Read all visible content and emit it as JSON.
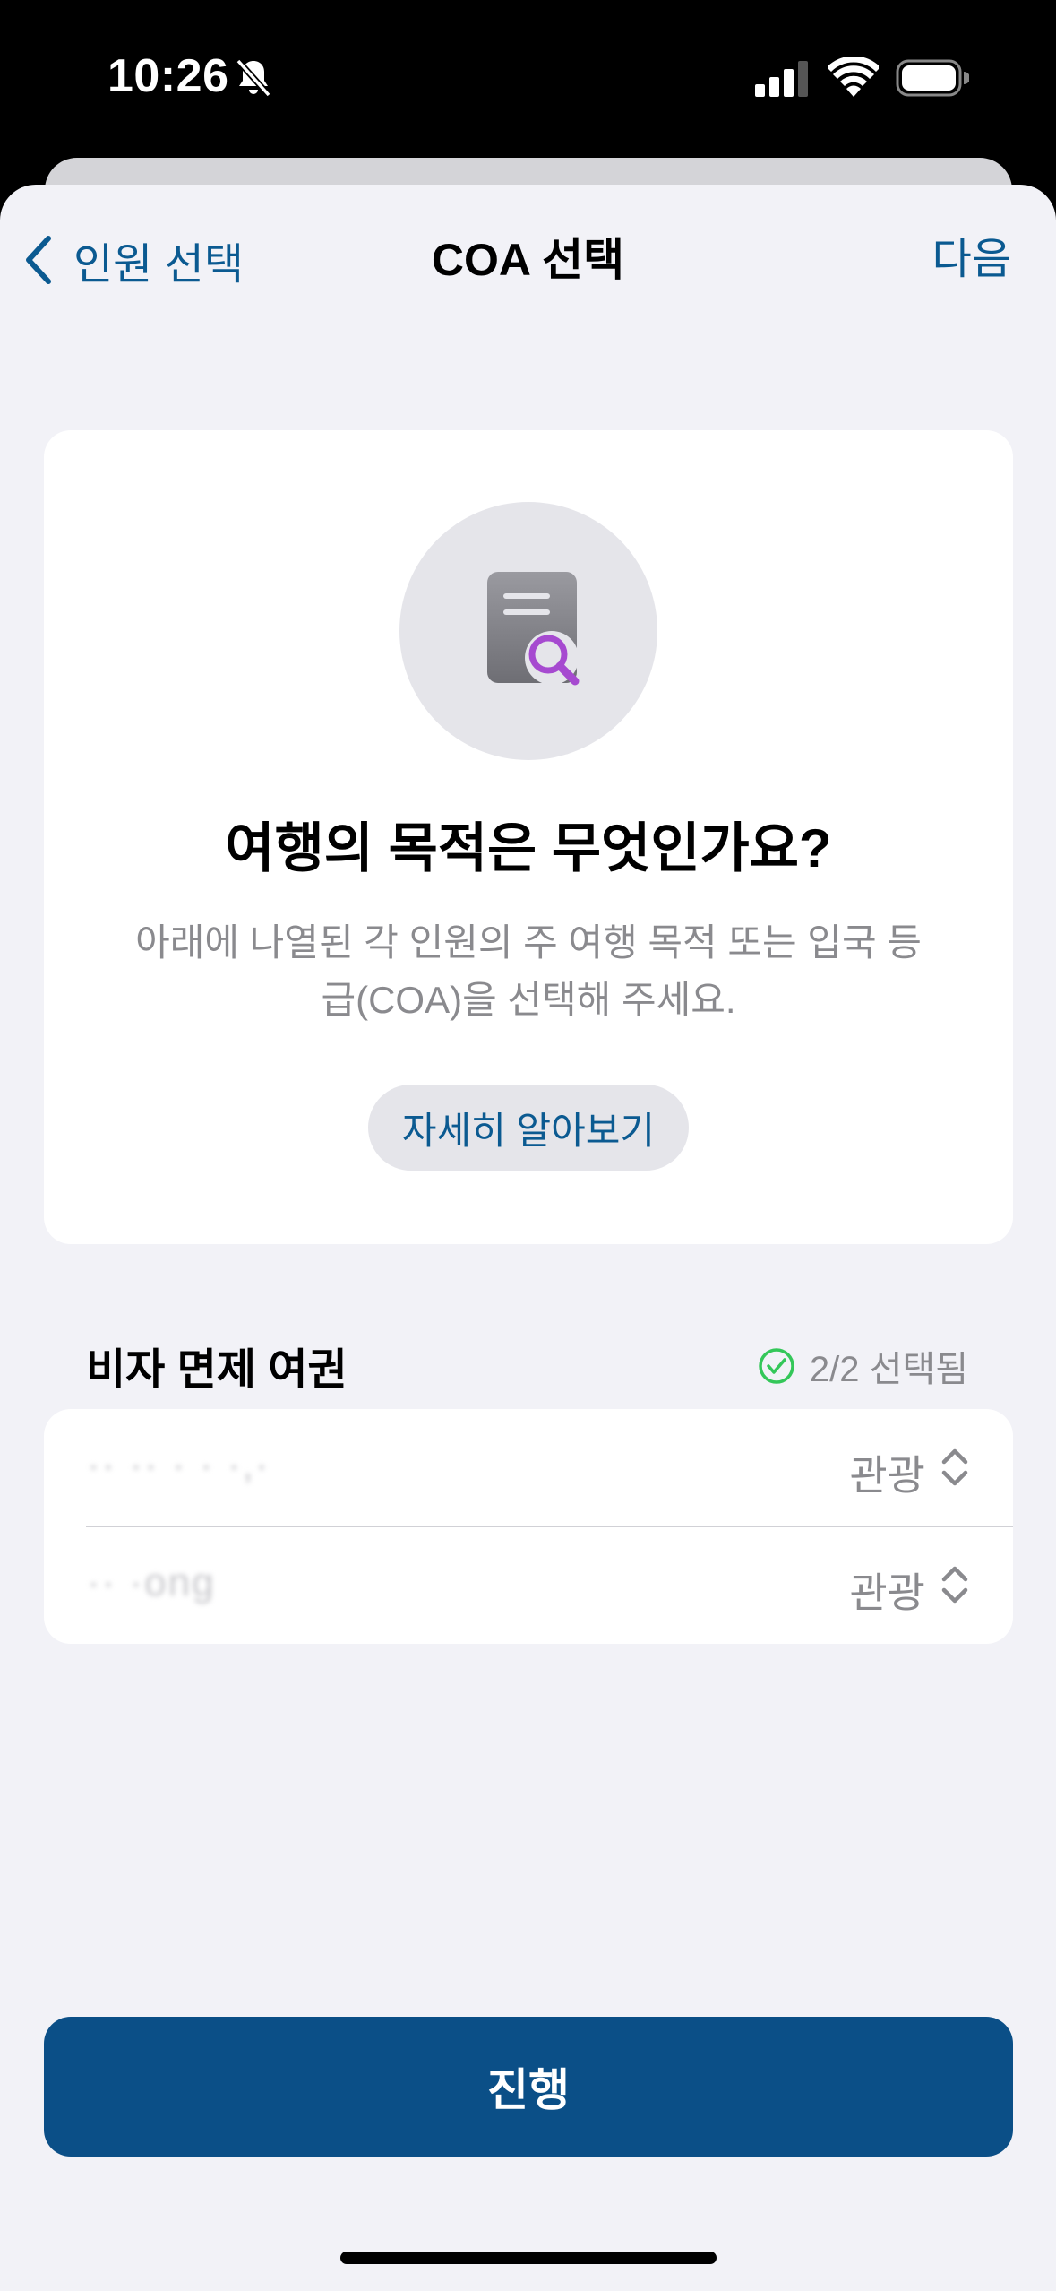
{
  "status_bar": {
    "time": "10:26",
    "icons": [
      "bell-slash-icon",
      "signal-icon",
      "wifi-icon",
      "battery-icon"
    ]
  },
  "nav": {
    "back_label": "인원 선택",
    "title": "COA 선택",
    "next_label": "다음"
  },
  "card": {
    "icon": "document-search-icon",
    "heading": "여행의 목적은 무엇인가요?",
    "description": "아래에 나열된 각 인원의 주 여행 목적 또는 입국 등급(COA)을 선택해 주세요.",
    "learn_more": "자세히 알아보기"
  },
  "section": {
    "title": "비자 면제 여권",
    "status": "2/2 선택됨"
  },
  "travelers": [
    {
      "name": "·· ·· · · ·,·",
      "value": "관광"
    },
    {
      "name": "·· ·ong",
      "value": "관광"
    }
  ],
  "proceed_label": "진행",
  "colors": {
    "accent": "#0b5a91",
    "button": "#0b4f87",
    "success": "#34c759",
    "background": "#f2f2f7"
  }
}
